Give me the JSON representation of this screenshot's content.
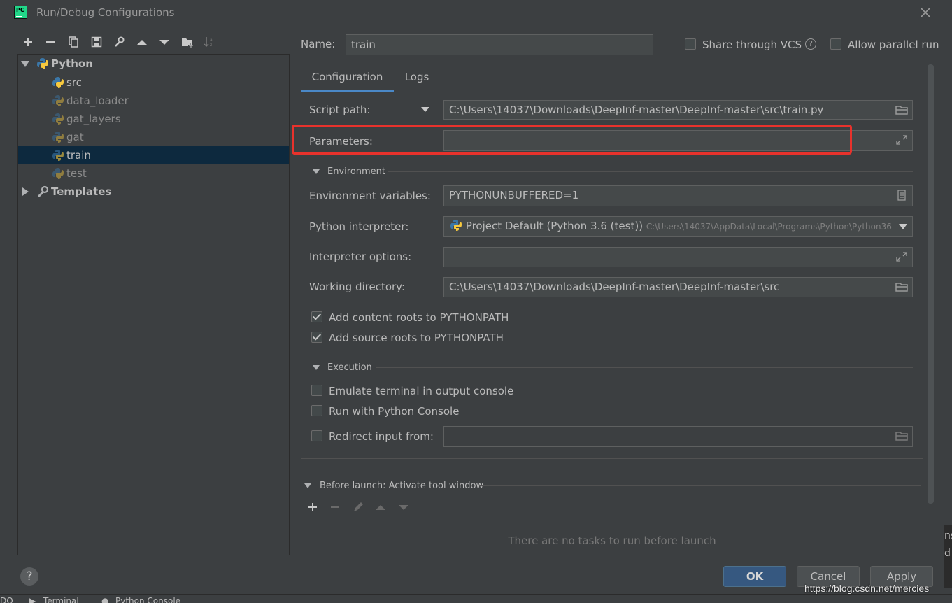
{
  "window": {
    "title": "Run/Debug Configurations",
    "logo_text": "PC"
  },
  "toolbar": {
    "icons": [
      "add-icon",
      "remove-icon",
      "copy-icon",
      "save-icon",
      "wrench-icon",
      "move-up-icon",
      "move-down-icon",
      "new-folder-icon",
      "sort-icon"
    ]
  },
  "tree": {
    "root_label": "Python",
    "items": [
      {
        "label": "src",
        "dim": false
      },
      {
        "label": "data_loader",
        "dim": true
      },
      {
        "label": "gat_layers",
        "dim": true
      },
      {
        "label": "gat",
        "dim": true
      },
      {
        "label": "train",
        "dim": false,
        "selected": true
      },
      {
        "label": "test",
        "dim": true
      }
    ],
    "templates_label": "Templates"
  },
  "header": {
    "name_label": "Name:",
    "name_value": "train",
    "share_vcs_label": "Share through VCS",
    "share_vcs_help": "?",
    "allow_parallel_label": "Allow parallel run"
  },
  "tabs": {
    "configuration": "Configuration",
    "logs": "Logs"
  },
  "form": {
    "script_path_label": "Script path:",
    "script_path_value": "C:\\Users\\14037\\Downloads\\DeepInf-master\\DeepInf-master\\src\\train.py",
    "parameters_label": "Parameters:",
    "parameters_value": "",
    "environment_section": "Environment",
    "env_vars_label": "Environment variables:",
    "env_vars_value": "PYTHONUNBUFFERED=1",
    "interpreter_label": "Python interpreter:",
    "interpreter_value": "Project Default (Python 3.6 (test))",
    "interpreter_path": "C:\\Users\\14037\\AppData\\Local\\Programs\\Python\\Python36",
    "interp_options_label": "Interpreter options:",
    "interp_options_value": "",
    "working_dir_label": "Working directory:",
    "working_dir_value": "C:\\Users\\14037\\Downloads\\DeepInf-master\\DeepInf-master\\src",
    "add_content_roots": "Add content roots to PYTHONPATH",
    "add_source_roots": "Add source roots to PYTHONPATH",
    "execution_section": "Execution",
    "emulate_terminal": "Emulate terminal in output console",
    "run_python_console": "Run with Python Console",
    "redirect_input": "Redirect input from:",
    "redirect_value": ""
  },
  "before_launch": {
    "title": "Before launch: Activate tool window",
    "empty_text": "There are no tasks to run before launch"
  },
  "buttons": {
    "help": "?",
    "ok": "OK",
    "cancel": "Cancel",
    "apply": "Apply"
  },
  "bottom_bar": {
    "terminal": "Terminal",
    "python_console": "Python Console",
    "left_fragment": "DO",
    "right_fragment_1": "ns",
    "right_fragment_2": "d"
  },
  "watermark": "https://blog.csdn.net/mercies",
  "colors": {
    "accent": "#365880",
    "highlight_box": "#e8322c",
    "selection": "#0d293e",
    "tab_underline": "#4a88c7"
  }
}
